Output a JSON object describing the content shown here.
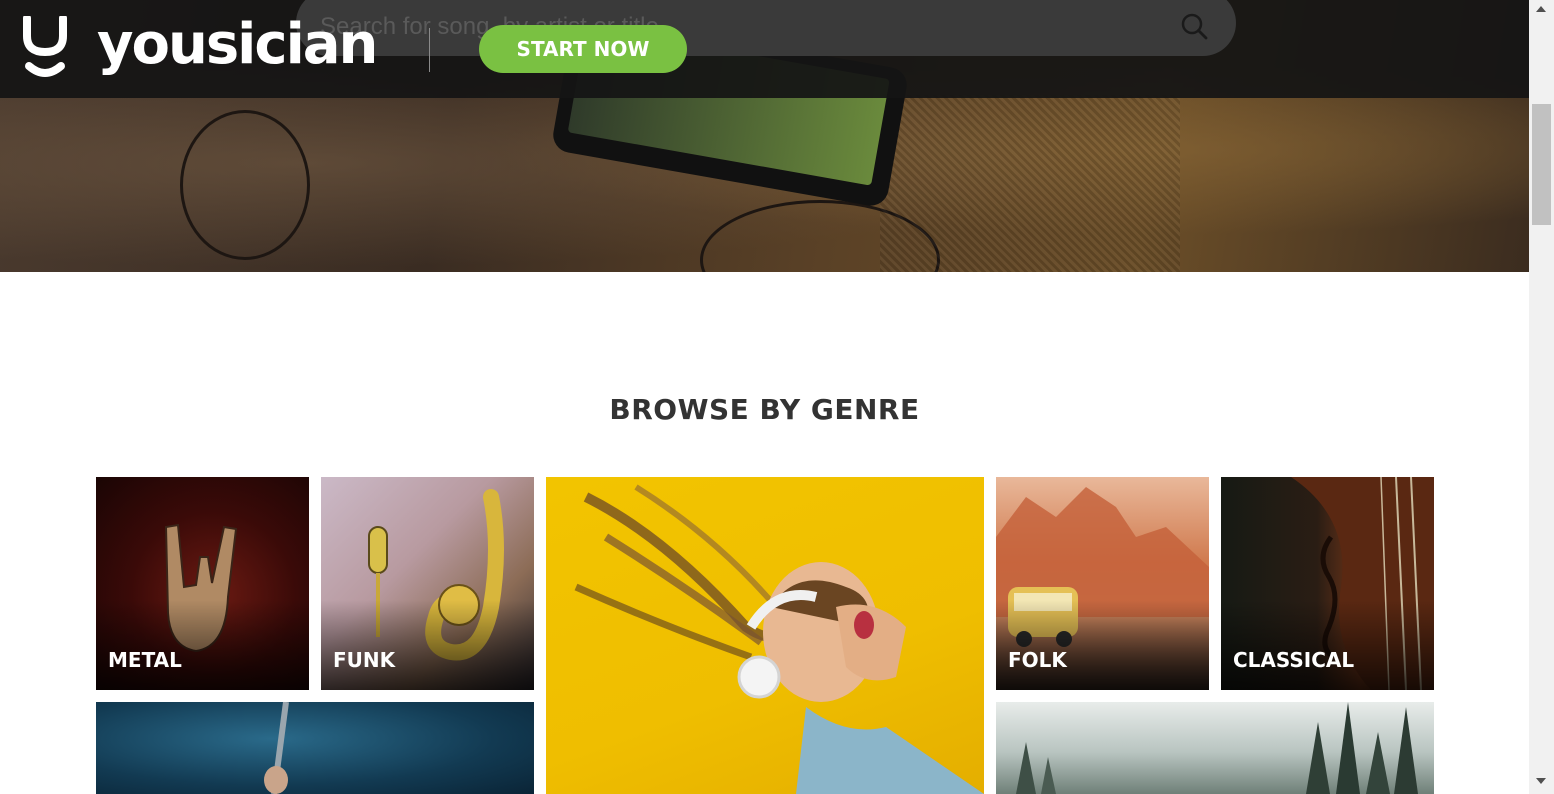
{
  "header": {
    "brand": "yousician",
    "search": {
      "placeholder": "Search for song, by artist or title"
    },
    "cta_label": "START NOW"
  },
  "main": {
    "section_title": "BROWSE BY GENRE",
    "genres": [
      {
        "label": "METAL"
      },
      {
        "label": "FUNK"
      },
      {
        "label": ""
      },
      {
        "label": "FOLK"
      },
      {
        "label": "CLASSICAL"
      },
      {
        "label": ""
      },
      {
        "label": ""
      }
    ]
  },
  "colors": {
    "accent": "#7ac142",
    "topbar": "#141414",
    "heading": "#333333"
  },
  "icons": [
    "yousician-logo-icon",
    "search-icon",
    "scroll-up-icon",
    "scroll-down-icon"
  ]
}
